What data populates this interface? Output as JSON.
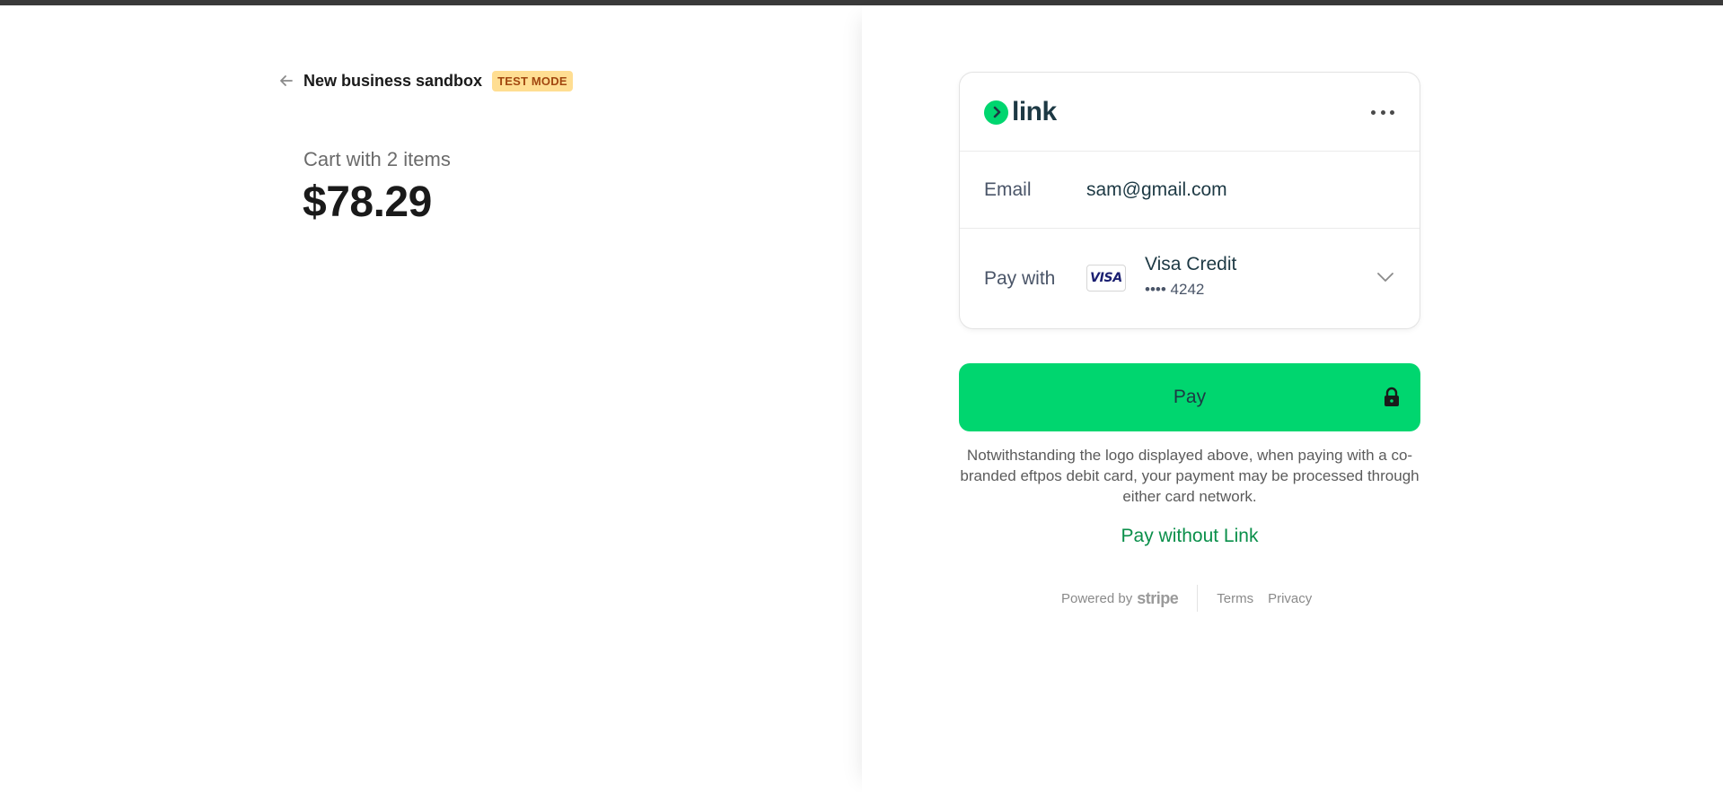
{
  "header": {
    "business_name": "New business sandbox",
    "badge": "TEST MODE"
  },
  "cart": {
    "label": "Cart with 2 items",
    "amount": "$78.29"
  },
  "link_card": {
    "logo_text": "link",
    "email_label": "Email",
    "email_value": "sam@gmail.com",
    "pay_with_label": "Pay with",
    "card_network_mark": "VISA",
    "card_brand": "Visa Credit",
    "card_last4": "•••• 4242"
  },
  "pay_button": {
    "label": "Pay"
  },
  "notice": "Notwithstanding the logo displayed above, when paying with a co-branded eftpos debit card, your payment may be processed through either card network.",
  "pay_without_link": "Pay without Link",
  "footer": {
    "powered_by": "Powered by",
    "stripe": "stripe",
    "terms": "Terms",
    "privacy": "Privacy"
  },
  "colors": {
    "link_green": "#00d66f",
    "link_text_green": "#0a8f4a",
    "badge_bg": "#ffde92",
    "badge_text": "#a2470f"
  },
  "icons": {
    "back": "arrow-left-icon",
    "more": "more-horizontal-icon",
    "chevron": "chevron-down-icon",
    "lock": "lock-icon"
  }
}
